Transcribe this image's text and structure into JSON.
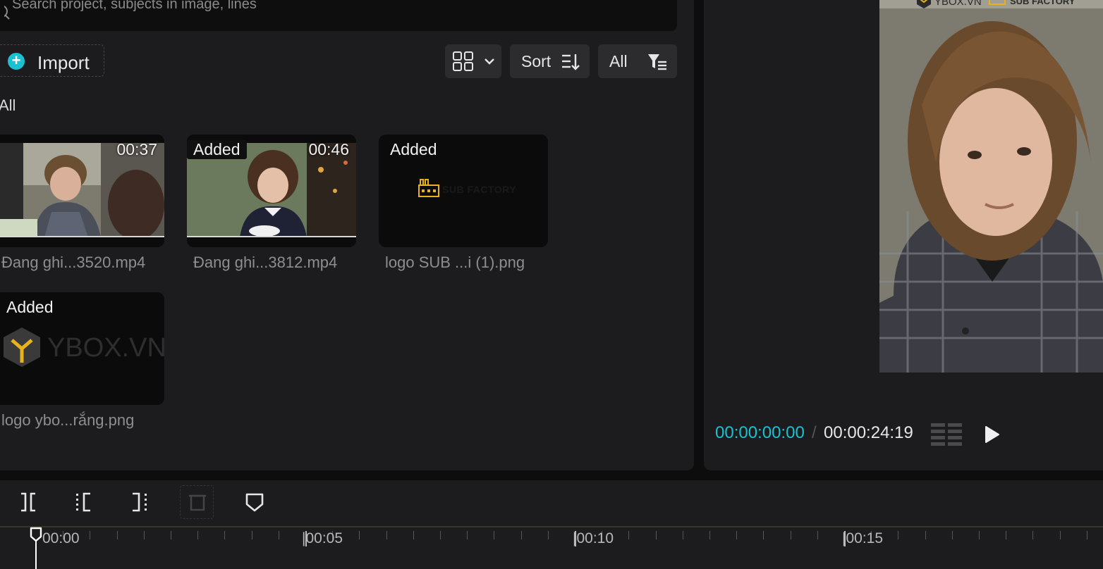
{
  "search": {
    "placeholder": "Search project, subjects in image, lines"
  },
  "toolbar": {
    "import_label": "Import",
    "sort_label": "Sort",
    "filter_label": "All"
  },
  "section": {
    "title": "All"
  },
  "media": [
    {
      "badge": "",
      "duration": "00:37",
      "name": "Đang ghi...3520.mp4"
    },
    {
      "badge": "Added",
      "duration": "00:46",
      "name": "Đang ghi...3812.mp4"
    },
    {
      "badge": "Added",
      "duration": "",
      "name": "logo SUB ...i (1).png",
      "logo_text": "SUB FACTORY"
    },
    {
      "badge": "Added",
      "duration": "",
      "name": "logo ybo...rắng.png",
      "logo_text": "YBOX.VN"
    }
  ],
  "player": {
    "current_time": "00:00:00:00",
    "separator": "/",
    "total_time": "00:00:24:19",
    "watermark_left": "YBOX.VN",
    "watermark_right": "SUB FACTORY"
  },
  "timeline": {
    "labels": [
      "00:00",
      "|00:05",
      "|00:10",
      "|00:15"
    ]
  },
  "colors": {
    "accent": "#19c1d1",
    "logo_gold": "#e8b21d"
  },
  "icons": {
    "search": "search-icon",
    "import": "plus-circle-icon",
    "view": "grid-view-icon",
    "sort": "sort-icon",
    "filter": "filter-icon",
    "play": "play-icon",
    "list": "list-icon",
    "split": "split-icon",
    "trim_left": "trim-left-icon",
    "trim_right": "trim-right-icon",
    "delete": "delete-icon",
    "marker": "marker-icon"
  }
}
